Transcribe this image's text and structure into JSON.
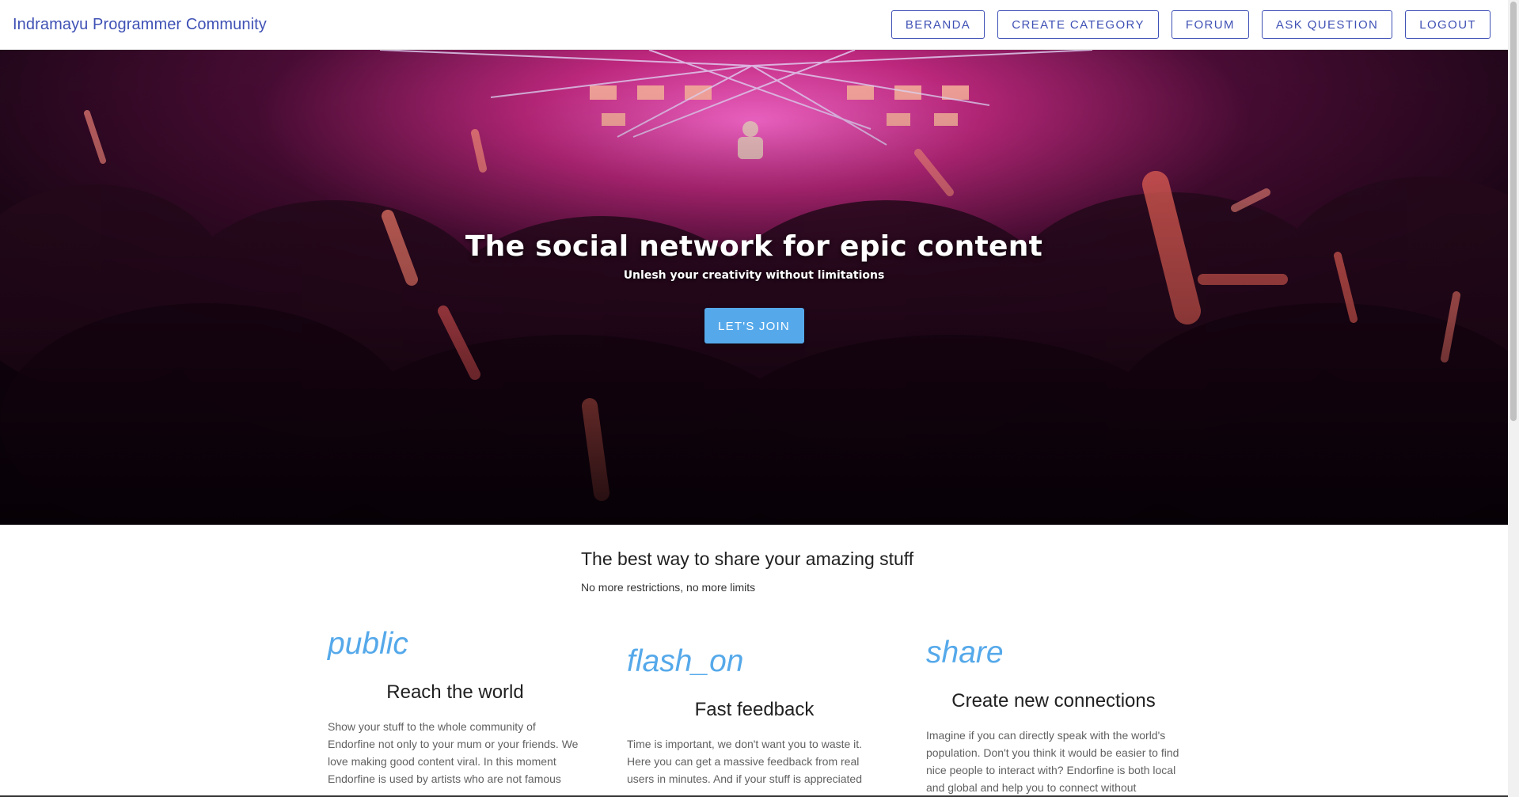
{
  "navbar": {
    "brand": "Indramayu Programmer Community",
    "buttons": [
      "BERANDA",
      "CREATE CATEGORY",
      "FORUM",
      "ASK QUESTION",
      "LOGOUT"
    ]
  },
  "hero": {
    "title": "The social network for epic content",
    "subtitle": "Unlesh your creativity without limitations",
    "button": "LET'S JOIN"
  },
  "intro": {
    "title": "The best way to share your amazing stuff",
    "subtitle": "No more restrictions, no more limits"
  },
  "features": [
    {
      "icon": "public",
      "title": "Reach the world",
      "text": "Show your stuff to the whole community of Endorfine not only to your mum or your friends. We love making good content viral. In this moment Endorfine is used by artists who are not famous"
    },
    {
      "icon": "flash_on",
      "title": "Fast feedback",
      "text": "Time is important, we don't want you to waste it. Here you can get a massive feedback from real users in minutes. And if your stuff is appreciated"
    },
    {
      "icon": "share",
      "title": "Create new connections",
      "text": "Imagine if you can directly speak with the world's population. Don't you think it would be easier to find nice people to interact with? Endorfine is both local and global and help you to connect without"
    }
  ],
  "colors": {
    "brand": "#3f51b5",
    "accent": "#55a9ea"
  }
}
